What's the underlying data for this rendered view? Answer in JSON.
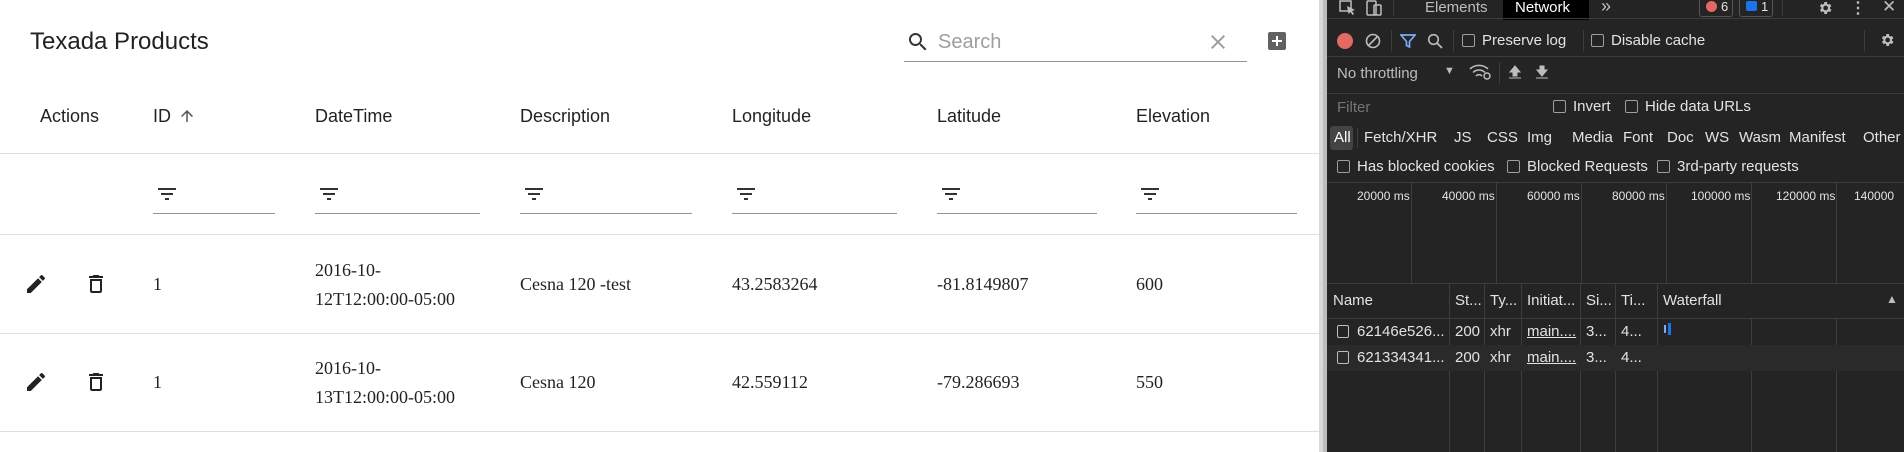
{
  "app": {
    "title": "Texada Products",
    "search": {
      "placeholder": "Search",
      "value": ""
    },
    "columns": [
      "Actions",
      "ID",
      "DateTime",
      "Description",
      "Longitude",
      "Latitude",
      "Elevation"
    ],
    "sort_column": "ID",
    "rows": [
      {
        "id": "1",
        "datetime_l1": "2016-10-",
        "datetime_l2": "12T12:00:00-05:00",
        "description": "Cesna 120 -test",
        "longitude": "43.2583264",
        "latitude": "-81.8149807",
        "elevation": "600"
      },
      {
        "id": "1",
        "datetime_l1": "2016-10-",
        "datetime_l2": "13T12:00:00-05:00",
        "description": "Cesna 120",
        "longitude": "42.559112",
        "latitude": "-79.286693",
        "elevation": "550"
      }
    ],
    "icons": {
      "search": "search-icon",
      "clear": "close-icon",
      "add": "add-box-icon",
      "filter": "filter-list-icon",
      "edit": "edit-icon",
      "delete": "delete-icon",
      "sort": "arrow-up-icon"
    }
  },
  "devtools": {
    "tabs": [
      "Elements",
      "Network"
    ],
    "active_tab": "Network",
    "more": "»",
    "error_count": "6",
    "message_count": "1",
    "preserve_log": "Preserve log",
    "disable_cache": "Disable cache",
    "throttling": "No throttling",
    "filter_placeholder": "Filter",
    "invert": "Invert",
    "hide_data_urls": "Hide data URLs",
    "type_filters": [
      "All",
      "Fetch/XHR",
      "JS",
      "CSS",
      "Img",
      "Media",
      "Font",
      "Doc",
      "WS",
      "Wasm",
      "Manifest",
      "Other"
    ],
    "has_blocked_cookies": "Has blocked cookies",
    "blocked_requests": "Blocked Requests",
    "third_party": "3rd-party requests",
    "timeline_ticks": [
      "20000 ms",
      "40000 ms",
      "60000 ms",
      "80000 ms",
      "100000 ms",
      "120000 ms",
      "140000"
    ],
    "table_headers": [
      "Name",
      "St...",
      "Ty...",
      "Initiat...",
      "Si...",
      "Ti...",
      "Waterfall"
    ],
    "requests": [
      {
        "name": "62146e526...",
        "status": "200",
        "type": "xhr",
        "initiator": "main....",
        "size": "3...",
        "time": "4..."
      },
      {
        "name": "621334341...",
        "status": "200",
        "type": "xhr",
        "initiator": "main....",
        "size": "3...",
        "time": "4..."
      }
    ],
    "colors": {
      "bg": "#242424",
      "accent": "#7cacf8",
      "record": "#e46962",
      "error": "#e46962",
      "info": "#1a73e8"
    }
  }
}
